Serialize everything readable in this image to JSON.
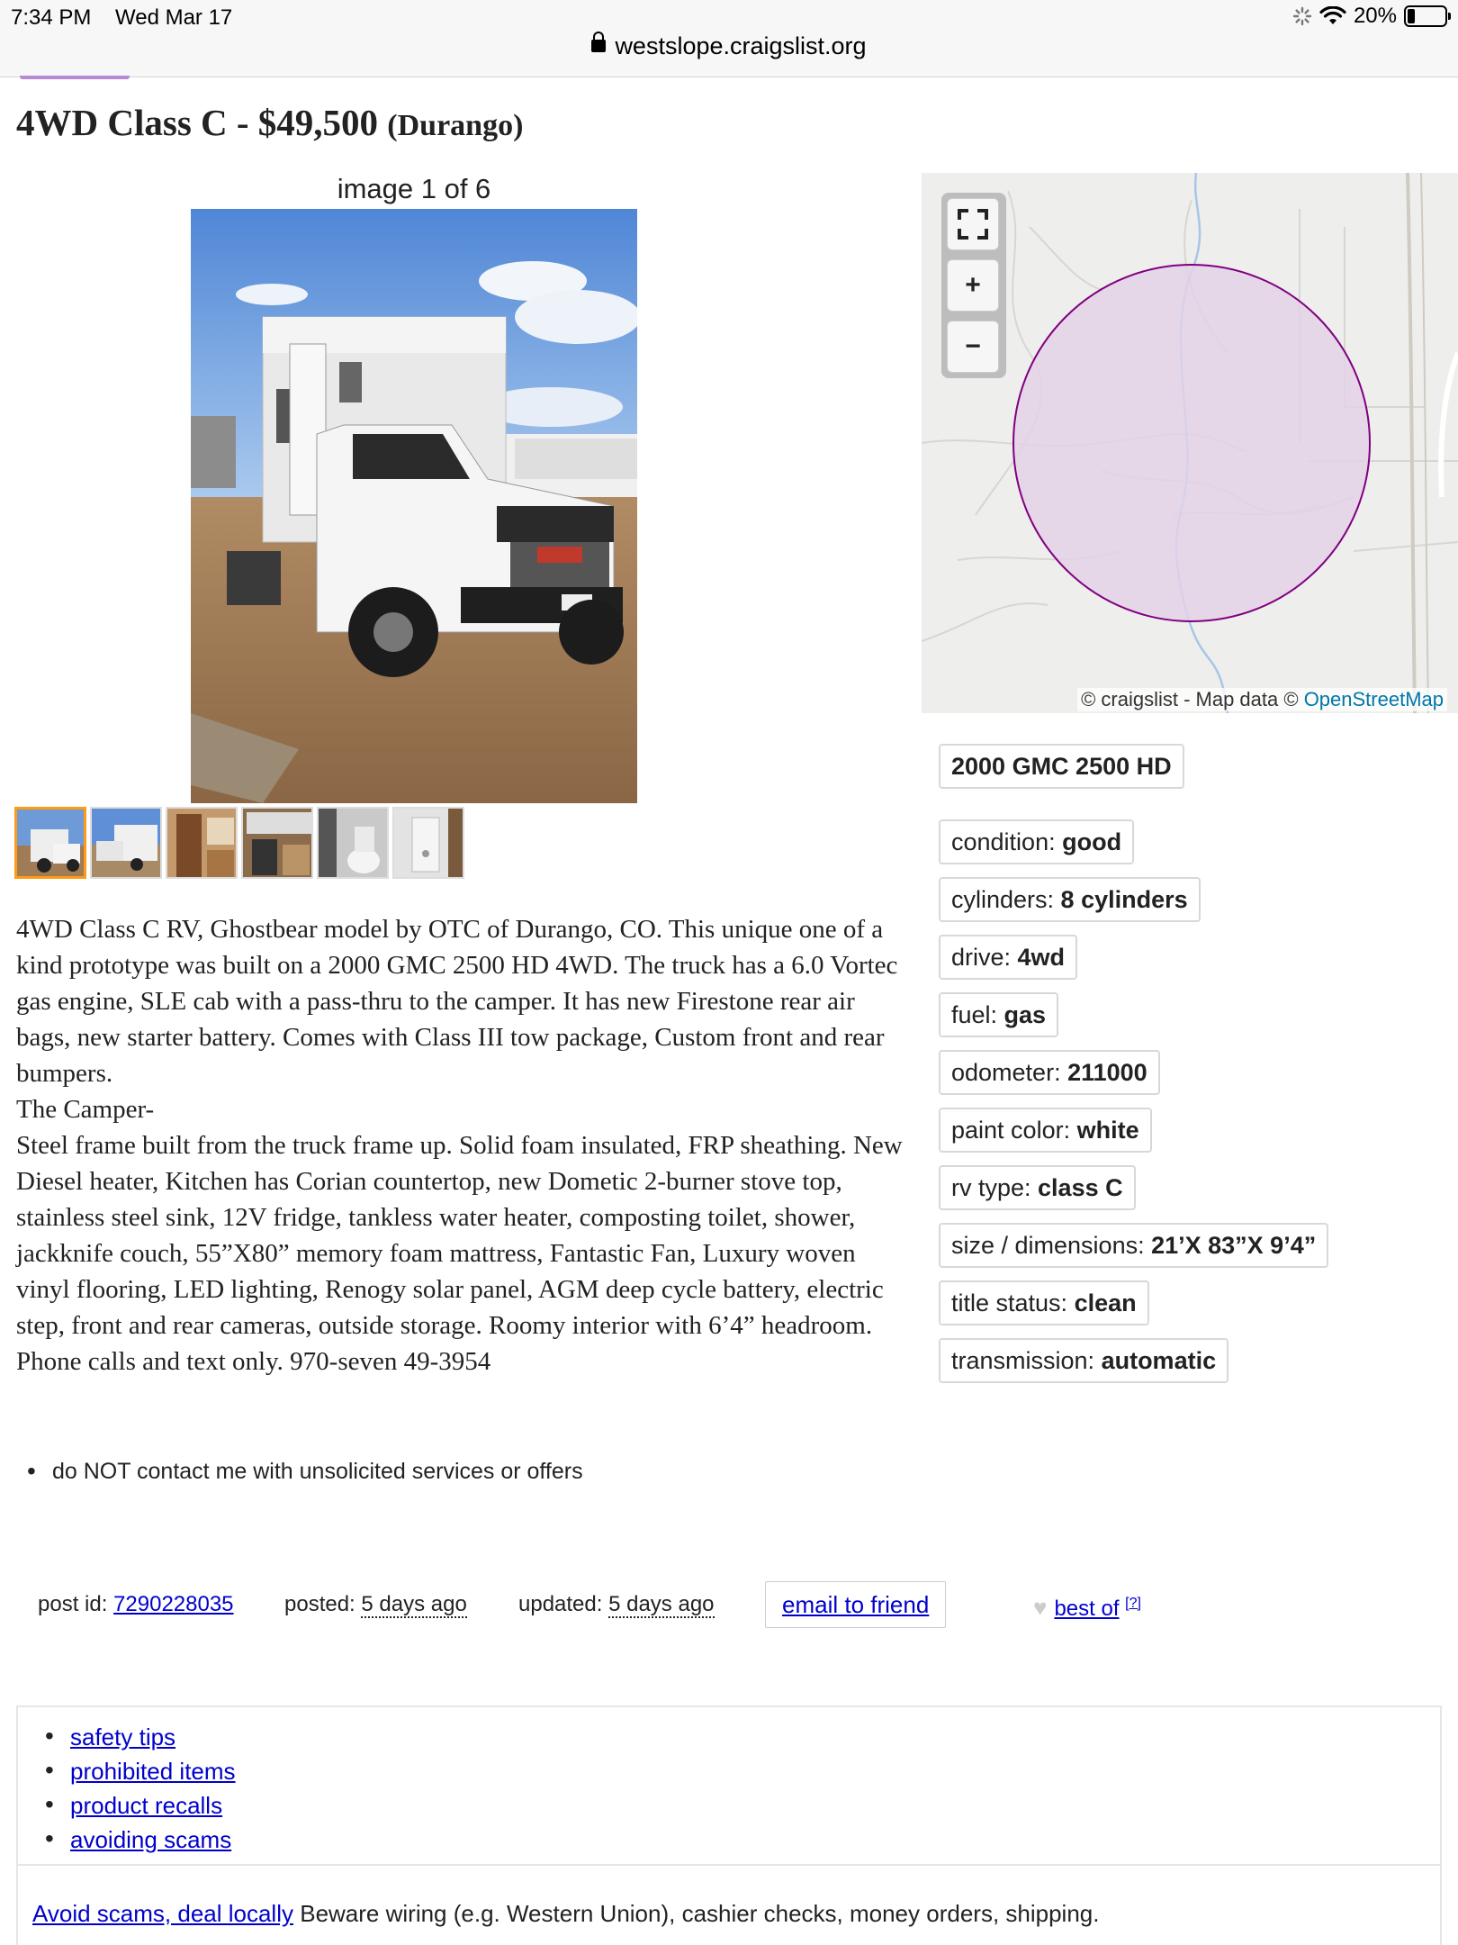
{
  "status_bar": {
    "time": "7:34 PM",
    "date": "Wed Mar 17",
    "battery": "20%",
    "battery_level": 0.2
  },
  "browser": {
    "url": "westslope.craigslist.org"
  },
  "listing": {
    "title": "4WD Class C - $49,500",
    "location": "(Durango)",
    "image_counter": "image 1 of 6",
    "thumbnail_count": 6,
    "description": [
      "4WD Class C RV, Ghostbear model by OTC of Durango, CO. This unique one of a kind prototype was built on a 2000 GMC 2500 HD 4WD. The truck has a 6.0 Vortec gas engine, SLE cab with a pass-thru to the camper. It has new Firestone rear air bags, new starter battery. Comes with Class III tow package, Custom front and rear bumpers.",
      "The Camper-",
      "Steel frame built from the truck frame up. Solid foam insulated, FRP sheathing. New Diesel heater, Kitchen has Corian countertop, new Dometic 2-burner stove top, stainless steel sink, 12V fridge, tankless water heater, composting toilet, shower, jackknife couch, 55”X80” memory foam mattress, Fantastic Fan, Luxury woven vinyl flooring, LED lighting, Renogy solar panel, AGM deep cycle battery, electric step, front and rear cameras, outside storage. Roomy interior with 6’4” headroom. Phone calls and text only. 970-seven 49-3954"
    ],
    "notice": "do NOT contact me with unsolicited services or offers"
  },
  "map": {
    "attribution": "© craigslist - Map data ©",
    "osm_link": "OpenStreetMap",
    "fullscreen_icon": "fullscreen-icon",
    "zoom_in": "+",
    "zoom_out": "−"
  },
  "attributes": {
    "vehicle": "2000 GMC 2500 HD",
    "items": [
      {
        "label": "condition: ",
        "value": "good"
      },
      {
        "label": "cylinders: ",
        "value": "8 cylinders"
      },
      {
        "label": "drive: ",
        "value": "4wd"
      },
      {
        "label": "fuel: ",
        "value": "gas"
      },
      {
        "label": "odometer: ",
        "value": "211000"
      },
      {
        "label": "paint color: ",
        "value": "white"
      },
      {
        "label": "rv type: ",
        "value": "class C"
      },
      {
        "label": "size / dimensions: ",
        "value": "21’X 83”X 9’4”"
      },
      {
        "label": "title status: ",
        "value": "clean"
      },
      {
        "label": "transmission: ",
        "value": "automatic"
      }
    ]
  },
  "post_info": {
    "post_id_label": "post id: ",
    "post_id": "7290228035",
    "posted_label": "posted: ",
    "posted": "5 days ago",
    "updated_label": "updated: ",
    "updated": "5 days ago",
    "email_friend": "email to friend",
    "best_of": "best of",
    "best_of_help": "[?]"
  },
  "footer": {
    "safety_links": [
      "safety tips",
      "prohibited items",
      "product recalls",
      "avoiding scams"
    ],
    "scam_link": "Avoid scams, deal locally",
    "scam_text": " Beware wiring (e.g. Western Union), cashier checks, money orders, shipping."
  },
  "colors": {
    "link": "#0000cc",
    "thumb_active": "#ff9b16",
    "map_circle_stroke": "#800080",
    "map_circle_fill": "#e3d2e8"
  }
}
